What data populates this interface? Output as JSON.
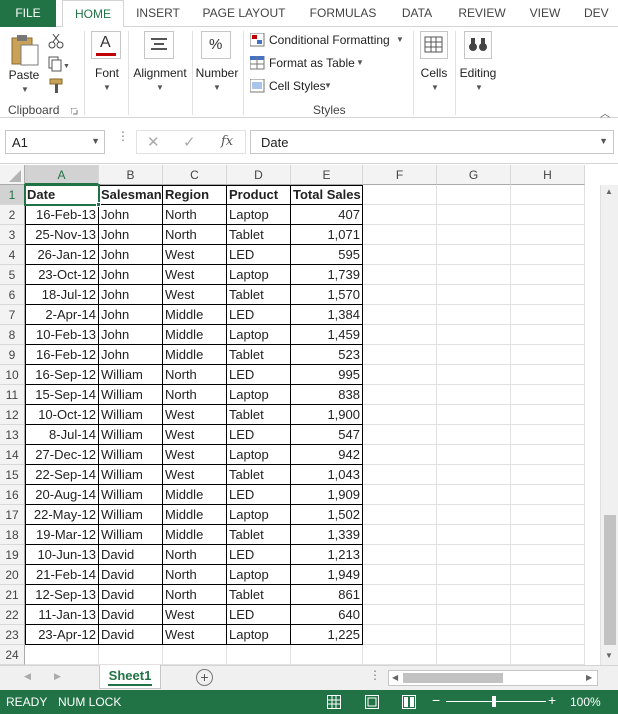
{
  "ribbon_tabs": [
    "FILE",
    "HOME",
    "INSERT",
    "PAGE LAYOUT",
    "FORMULAS",
    "DATA",
    "REVIEW",
    "VIEW",
    "DEV"
  ],
  "ribbon": {
    "paste": "Paste",
    "clipboard": "Clipboard",
    "font": "Font",
    "alignment": "Alignment",
    "number": "Number",
    "conditional_formatting": "Conditional Formatting",
    "format_as_table": "Format as Table",
    "cell_styles": "Cell Styles",
    "styles": "Styles",
    "cells": "Cells",
    "editing": "Editing"
  },
  "formula_bar": {
    "name_box": "A1",
    "formula": "Date",
    "fx": "fx"
  },
  "columns": [
    "A",
    "B",
    "C",
    "D",
    "E",
    "F",
    "G",
    "H"
  ],
  "header_row": [
    "Date",
    "Salesman",
    "Region",
    "Product",
    "Total Sales"
  ],
  "rows": [
    [
      "16-Feb-13",
      "John",
      "North",
      "Laptop",
      "407"
    ],
    [
      "25-Nov-13",
      "John",
      "North",
      "Tablet",
      "1,071"
    ],
    [
      "26-Jan-12",
      "John",
      "West",
      "LED",
      "595"
    ],
    [
      "23-Oct-12",
      "John",
      "West",
      "Laptop",
      "1,739"
    ],
    [
      "18-Jul-12",
      "John",
      "West",
      "Tablet",
      "1,570"
    ],
    [
      "2-Apr-14",
      "John",
      "Middle",
      "LED",
      "1,384"
    ],
    [
      "10-Feb-13",
      "John",
      "Middle",
      "Laptop",
      "1,459"
    ],
    [
      "16-Feb-12",
      "John",
      "Middle",
      "Tablet",
      "523"
    ],
    [
      "16-Sep-12",
      "William",
      "North",
      "LED",
      "995"
    ],
    [
      "15-Sep-14",
      "William",
      "North",
      "Laptop",
      "838"
    ],
    [
      "10-Oct-12",
      "William",
      "West",
      "Tablet",
      "1,900"
    ],
    [
      "8-Jul-14",
      "William",
      "West",
      "LED",
      "547"
    ],
    [
      "27-Dec-12",
      "William",
      "West",
      "Laptop",
      "942"
    ],
    [
      "22-Sep-14",
      "William",
      "West",
      "Tablet",
      "1,043"
    ],
    [
      "20-Aug-14",
      "William",
      "Middle",
      "LED",
      "1,909"
    ],
    [
      "22-May-12",
      "William",
      "Middle",
      "Laptop",
      "1,502"
    ],
    [
      "19-Mar-12",
      "William",
      "Middle",
      "Tablet",
      "1,339"
    ],
    [
      "10-Jun-13",
      "David",
      "North",
      "LED",
      "1,213"
    ],
    [
      "21-Feb-14",
      "David",
      "North",
      "Laptop",
      "1,949"
    ],
    [
      "12-Sep-13",
      "David",
      "North",
      "Tablet",
      "861"
    ],
    [
      "11-Jan-13",
      "David",
      "West",
      "LED",
      "640"
    ],
    [
      "23-Apr-12",
      "David",
      "West",
      "Laptop",
      "1,225"
    ]
  ],
  "row_numbers": [
    "1",
    "2",
    "3",
    "4",
    "5",
    "6",
    "7",
    "8",
    "9",
    "10",
    "11",
    "12",
    "13",
    "14",
    "15",
    "16",
    "17",
    "18",
    "19",
    "20",
    "21",
    "22",
    "23",
    "24"
  ],
  "sheet_tab": "Sheet1",
  "status": {
    "ready": "READY",
    "num_lock": "NUM LOCK",
    "zoom": "100%"
  },
  "colors": {
    "accent": "#217346"
  }
}
